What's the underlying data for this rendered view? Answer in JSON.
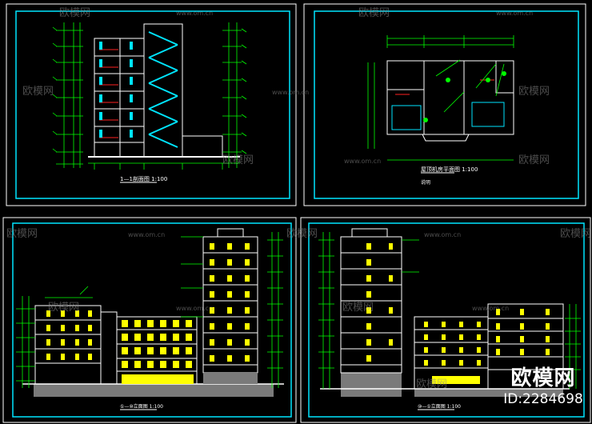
{
  "watermark": {
    "brand": "欧模网",
    "url": "www.om.cn"
  },
  "badge": {
    "brand": "欧模网",
    "id": "ID:2284698"
  },
  "panels": {
    "section": {
      "title": "1—1剖面图 1:100"
    },
    "roof_plan": {
      "title": "屋顶机房平面图 1:100",
      "note": "说明"
    },
    "elevation_left": {
      "title": "①—⑩立面图 1:100"
    },
    "elevation_right": {
      "title": "⑩—①立面图 1:100"
    }
  },
  "colors": {
    "background": "#000000",
    "frame": "#00e5ff",
    "line": "#ffffff",
    "dimension": "#00ff00",
    "window": "#ffff00",
    "stair": "#00e5ff",
    "ground": "#7a7a7a",
    "accent_red": "#ff2020",
    "accent_magenta": "#ff40ff"
  }
}
